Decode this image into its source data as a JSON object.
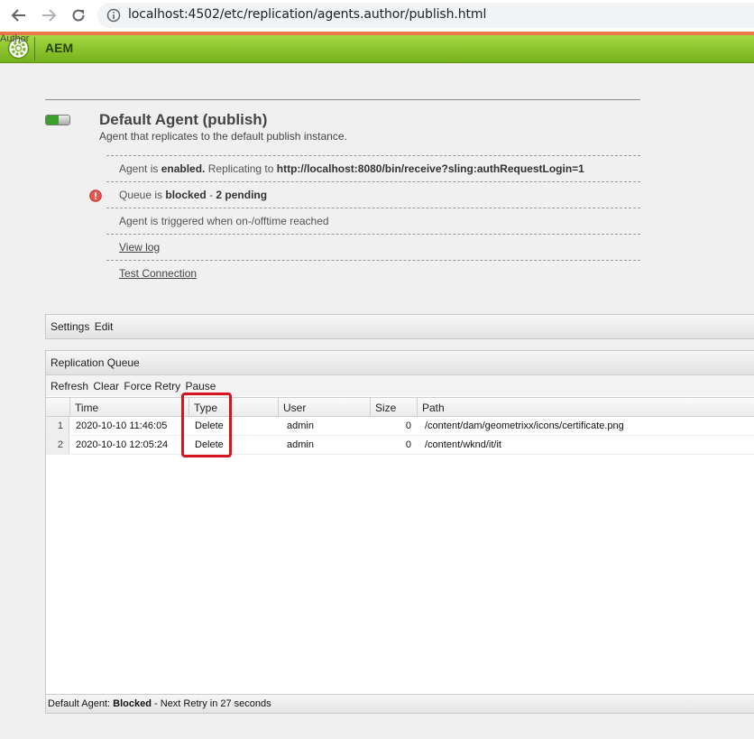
{
  "browser": {
    "url": "localhost:4502/etc/replication/agents.author/publish.html",
    "back_icon": "back-arrow-icon",
    "forward_icon": "forward-arrow-icon",
    "reload_icon": "reload-icon",
    "info_icon": "info-icon"
  },
  "header": {
    "author_label": "Author",
    "app_title": "AEM",
    "accent_color": "#74b11c"
  },
  "agent": {
    "title": "Default Agent (publish)",
    "description": "Agent that replicates to the default publish instance.",
    "status_prefix": "Agent is ",
    "status_value": "enabled.",
    "replicating_prefix": " Replicating to ",
    "replicating_url": "http://localhost:8080/bin/receive?sling:authRequestLogin=1",
    "queue_prefix": "Queue is ",
    "queue_state": "blocked",
    "queue_sep": " - ",
    "queue_pending": "2 pending",
    "trigger_text": "Agent is triggered when on-/offtime reached",
    "view_log": "View log",
    "test_connection": "Test Connection"
  },
  "settings": {
    "settings_label": "Settings",
    "edit_label": "Edit"
  },
  "queue": {
    "title": "Replication Queue",
    "toolbar": {
      "refresh": "Refresh",
      "clear": "Clear",
      "force_retry": "Force Retry",
      "pause": "Pause"
    },
    "columns": {
      "time": "Time",
      "type": "Type",
      "user": "User",
      "size": "Size",
      "path": "Path"
    },
    "rows": [
      {
        "num": "1",
        "time": "2020-10-10 11:46:05",
        "type": "Delete",
        "user": "admin",
        "size": "0",
        "path": "/content/dam/geometrixx/icons/certificate.png"
      },
      {
        "num": "2",
        "time": "2020-10-10 12:05:24",
        "type": "Delete",
        "user": "admin",
        "size": "0",
        "path": "/content/wknd/it/it"
      }
    ]
  },
  "status": {
    "prefix": "Default Agent: ",
    "state": "Blocked",
    "suffix": " - Next Retry in 27 seconds"
  }
}
